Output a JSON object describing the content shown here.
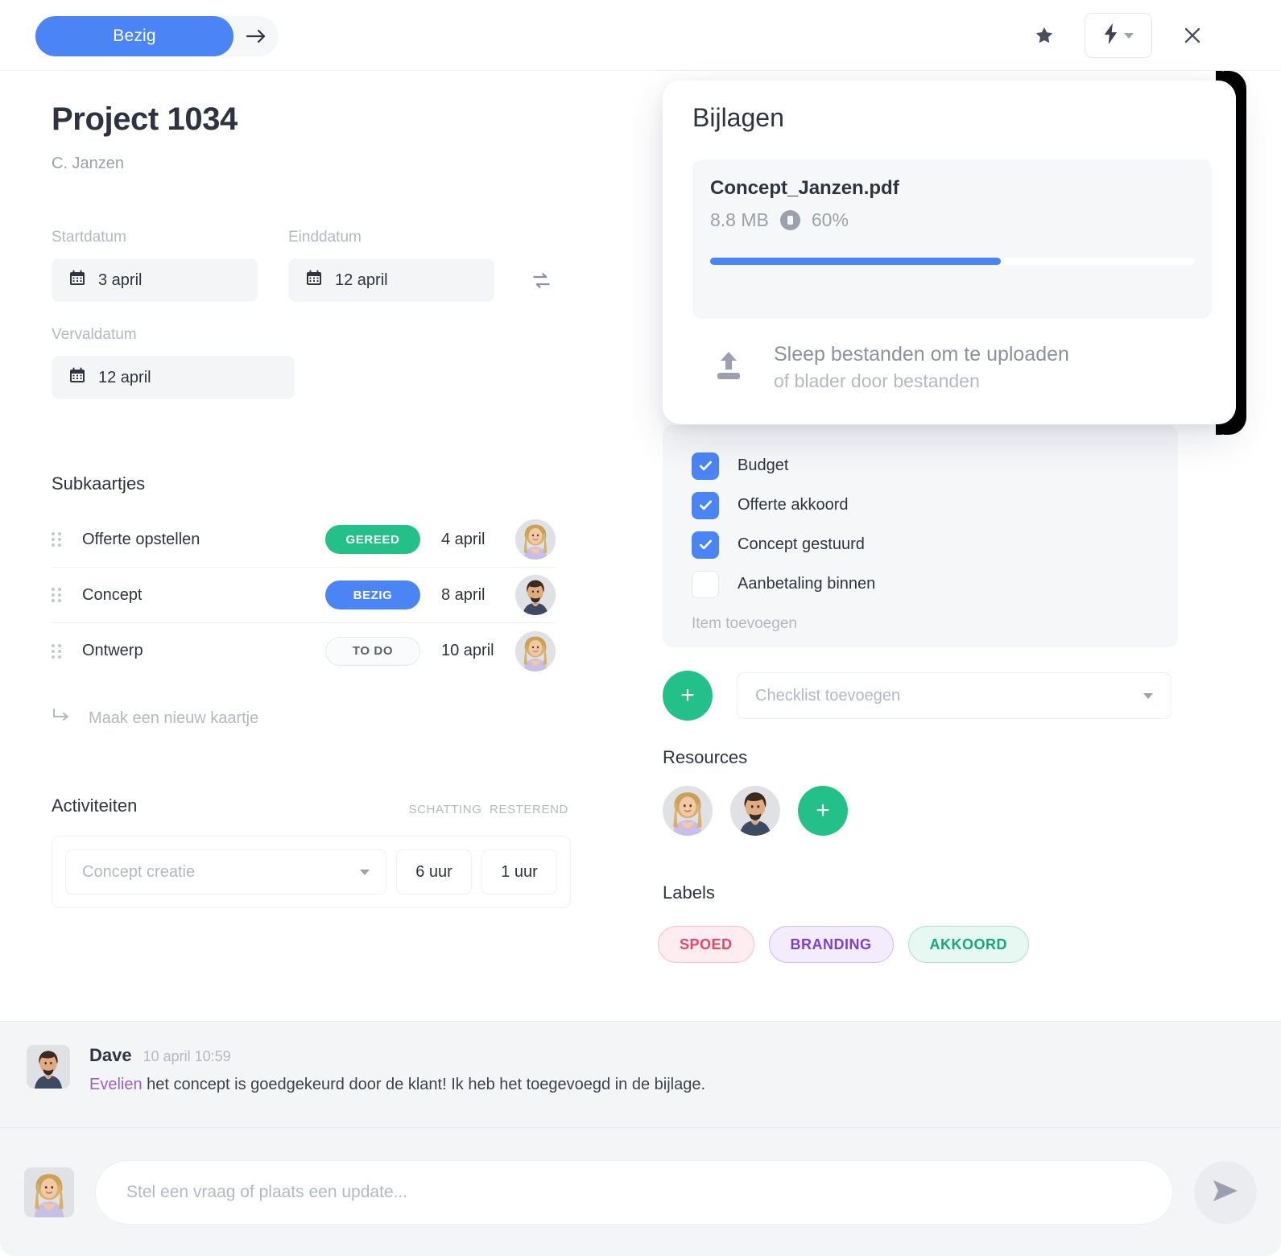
{
  "topbar": {
    "status_label": "Bezig",
    "next_icon": "arrow-right-icon",
    "star_icon": "star-icon",
    "bolt_icon": "lightning-bolt-icon",
    "close_icon": "close-icon"
  },
  "project": {
    "title": "Project 1034",
    "client": "C. Janzen"
  },
  "dates": {
    "start_label": "Startdatum",
    "start_value": "3 april",
    "end_label": "Einddatum",
    "end_value": "12 april",
    "due_label": "Vervaldatum",
    "due_value": "12 april",
    "swap_icon": "sync-arrows-icon",
    "calendar_icon": "calendar-icon"
  },
  "subcards": {
    "title": "Subkaartjes",
    "add_label": "Maak een nieuw kaartje",
    "add_icon": "arrow-turn-down-right-icon",
    "rows": [
      {
        "name": "Offerte opstellen",
        "status": "GEREED",
        "status_style": "b-green",
        "date": "4 april",
        "avatar": "woman"
      },
      {
        "name": "Concept",
        "status": "BEZIG",
        "status_style": "b-blue",
        "date": "8 april",
        "avatar": "man"
      },
      {
        "name": "Ontwerp",
        "status": "TO DO",
        "status_style": "b-todo",
        "date": "10 april",
        "avatar": "woman"
      }
    ]
  },
  "activities": {
    "title": "Activiteiten",
    "col_estimate": "SCHATTING",
    "col_remaining": "RESTEREND",
    "select_placeholder": "Concept creatie",
    "estimate_value": "6 uur",
    "remaining_value": "1 uur"
  },
  "checklist": {
    "items": [
      {
        "label": "Budget",
        "checked": true
      },
      {
        "label": "Offerte akkoord",
        "checked": true
      },
      {
        "label": "Concept gestuurd",
        "checked": true
      },
      {
        "label": "Aanbetaling binnen",
        "checked": false
      }
    ],
    "add_item_label": "Item toevoegen",
    "add_checklist_placeholder": "Checklist toevoegen",
    "add_button_icon": "plus-icon"
  },
  "resources": {
    "title": "Resources",
    "avatars": [
      "woman",
      "man"
    ],
    "add_icon": "plus-icon"
  },
  "labels": {
    "title": "Labels",
    "tags": [
      {
        "text": "SPOED",
        "color": "#e8446a",
        "bg": "#fdecf0",
        "border": "#f6c2cf"
      },
      {
        "text": "BRANDING",
        "color": "#7b3fd4",
        "bg": "#f2ecfd",
        "border": "#d2bdf5"
      },
      {
        "text": "AKKOORD",
        "color": "#15a97a",
        "bg": "#e6f8f1",
        "border": "#a8e6d0"
      }
    ]
  },
  "attachments": {
    "title": "Bijlagen",
    "file_name": "Concept_Janzen.pdf",
    "file_size": "8.8 MB",
    "progress_text": "60%",
    "progress_percent": 60,
    "pause_icon": "pause-circle-icon",
    "upload_icon": "upload-icon",
    "drop_line1": "Sleep bestanden om te uploaden",
    "drop_line2": "of blader door bestanden",
    "accent_color": "#4a84f5"
  },
  "comment": {
    "author": "Dave",
    "timestamp": "10 april 10:59",
    "mention": "Evelien",
    "text": " het concept is goedgekeurd door de klant! Ik heb het toegevoegd in de bijlage."
  },
  "composer": {
    "placeholder": "Stel een vraag of plaats een update...",
    "send_icon": "send-icon"
  }
}
